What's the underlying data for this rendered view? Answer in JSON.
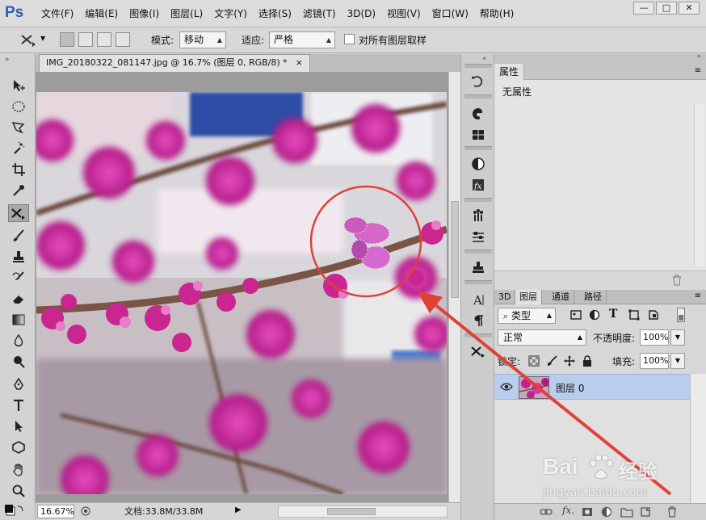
{
  "app": {
    "logo": "Ps"
  },
  "menu": [
    "文件(F)",
    "编辑(E)",
    "图像(I)",
    "图层(L)",
    "文字(Y)",
    "选择(S)",
    "滤镜(T)",
    "3D(D)",
    "视图(V)",
    "窗口(W)",
    "帮助(H)"
  ],
  "window_controls": {
    "minimize": "—",
    "maximize": "□",
    "close": "✕"
  },
  "options": {
    "mode_label": "模式:",
    "mode_value": "移动",
    "adapt_label": "适应:",
    "adapt_value": "严格",
    "sample_all_label": "对所有图层取样",
    "sample_all_checked": false
  },
  "document": {
    "tab_title": "IMG_20180322_081147.jpg @ 16.7% (图层 0, RGB/8) *",
    "close": "×"
  },
  "status": {
    "zoom": "16.67%",
    "doc_info": "文档:33.8M/33.8M",
    "arrow": "▶"
  },
  "properties": {
    "tab_label": "属性",
    "content": "无属性"
  },
  "layers": {
    "tabs": [
      "3D",
      "图层",
      "通道",
      "路径"
    ],
    "selected_tab": "图层",
    "filter_label": "类型",
    "blend_mode": "正常",
    "opacity_label": "不透明度:",
    "opacity_value": "100%",
    "lock_label": "锁定:",
    "fill_label": "填充:",
    "fill_value": "100%",
    "items": [
      {
        "name": "图层 0",
        "visible": true,
        "selected": true
      }
    ]
  },
  "watermark": {
    "brand": "Bai",
    "brand_suffix": "经验",
    "url": "jingyan.baidu.com"
  },
  "colors": {
    "app_bg": "#d6d6d6",
    "selected_layer": "#b9cdec",
    "annotation_red": "#e0413a",
    "ps_blue": "#2a60b0",
    "blossom": "#c2208f"
  }
}
